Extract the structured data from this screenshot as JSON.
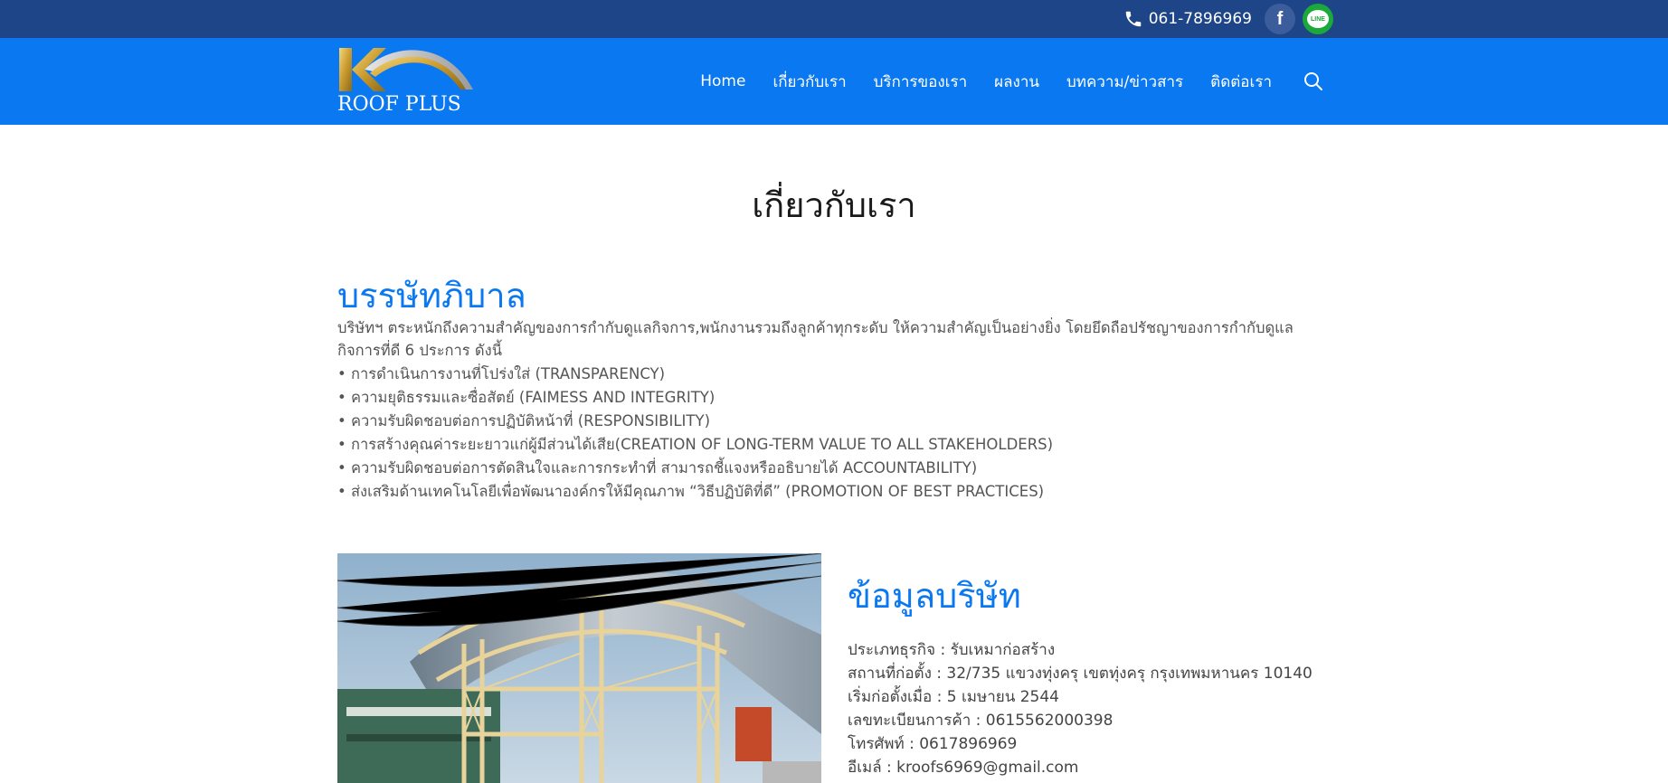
{
  "topbar": {
    "phone": "061-7896969",
    "facebook_glyph": "f",
    "line_label": "LINE",
    "colors": {
      "background": "#1d4587",
      "facebook": "#3b5d9c",
      "line": "#1aa93a"
    }
  },
  "nav": {
    "logo_text": "ROOF PLUS",
    "items": [
      "Home",
      "เกี่ยวกับเรา",
      "บริการของเรา",
      "ผลงาน",
      "บทความ/ข่าวสาร",
      "ติดต่อเรา"
    ],
    "background": "#0a78f0"
  },
  "page_title": "เกี่ยวกับเรา",
  "governance": {
    "title": "บรรษัทภิบาล",
    "intro": "บริษัทฯ ตระหนักถึงความสำคัญของการกำกับดูแลกิจการ,พนักงานรวมถึงลูกค้าทุกระดับ ให้ความสำคัญเป็นอย่างยิ่ง โดยยึดถือปรัชญาของการกำกับดูแลกิจการที่ดี 6 ประการ ดังนี้",
    "bullets": [
      "• การดำเนินการงานที่โปร่งใส่ (TRANSPARENCY)",
      "• ความยุติธรรมและซื่อสัตย์ (FAIMESS AND INTEGRITY)",
      "• ความรับผิดชอบต่อการปฏิบัติหน้าที่ (RESPONSIBILITY)",
      "• การสร้างคุณค่าระยะยาวแก่ผู้มีส่วนได้เสีย(CREATION OF LONG-TERM VALUE TO ALL STAKEHOLDERS)",
      "• ความรับผิดชอบต่อการตัดสินใจและการกระทำที่ สามารถชี้แจงหรืออธิบายได้ ACCOUNTABILITY)",
      "• ส่งเสริมด้านเทคโนโลยีเพื่อพัฒนาองค์กรให้มีคุณภาพ “วิธีปฏิบัติที่ดี” (PROMOTION OF BEST PRACTICES)"
    ]
  },
  "company": {
    "title": "ข้อมูลบริษัท",
    "details": [
      "ประเภทธุรกิจ : รับเหมาก่อสร้าง",
      "สถานที่ก่อตั้ง : 32/735 แขวงทุ่งครุ เขตทุ่งครุ กรุงเทพมหานคร 10140",
      "เริ่มก่อตั้งเมื่อ : 5 เมษายน 2544",
      "เลขทะเบียนการค้า : 0615562000398",
      "โทรศัพท์ : 0617896969",
      "อีเมล์ : kroofs6969@gmail.com"
    ]
  }
}
